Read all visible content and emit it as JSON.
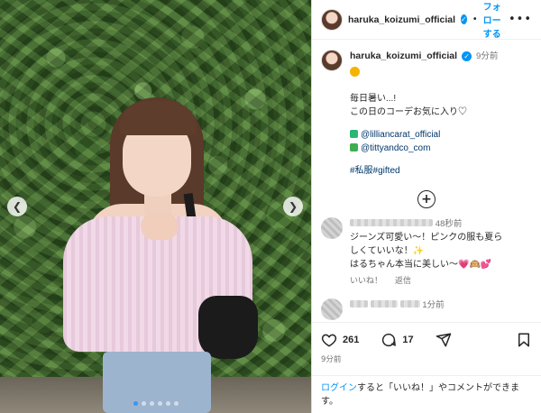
{
  "header": {
    "username": "haruka_koizumi_official",
    "separator": "•",
    "follow_label": "フォローする",
    "more": "•••"
  },
  "caption": {
    "username": "haruka_koizumi_official",
    "time": "9分前",
    "emoji": "sun-emoji",
    "lines": [
      "毎日暑い...!",
      "この日のコーデお気に入り♡"
    ],
    "credits": [
      {
        "icon": "green-shirt-emoji",
        "handle": "@lilliancarat_official"
      },
      {
        "icon": "green-pants-emoji",
        "handle": "@tittyandco_com"
      }
    ],
    "hashtags": "#私服#gifted"
  },
  "comments": [
    {
      "time": "48秒前",
      "lines": [
        "ジーンズ可愛い〜！ピンクの服も夏ら",
        "しくていいな！✨",
        "はるちゃん本当に美しい〜💗🙉💕"
      ],
      "like_label": "いいね！",
      "reply_label": "返信"
    },
    {
      "time": "1分前"
    }
  ],
  "actions": {
    "like_count": "261",
    "comment_count": "17",
    "post_time": "9分前"
  },
  "login": {
    "link_text": "ログイン",
    "rest_text": "すると「いいね！」やコメントができます。"
  },
  "carousel": {
    "dots": 6,
    "active_index": 0
  },
  "colors": {
    "accent": "#0095f6",
    "link": "#00376b"
  }
}
